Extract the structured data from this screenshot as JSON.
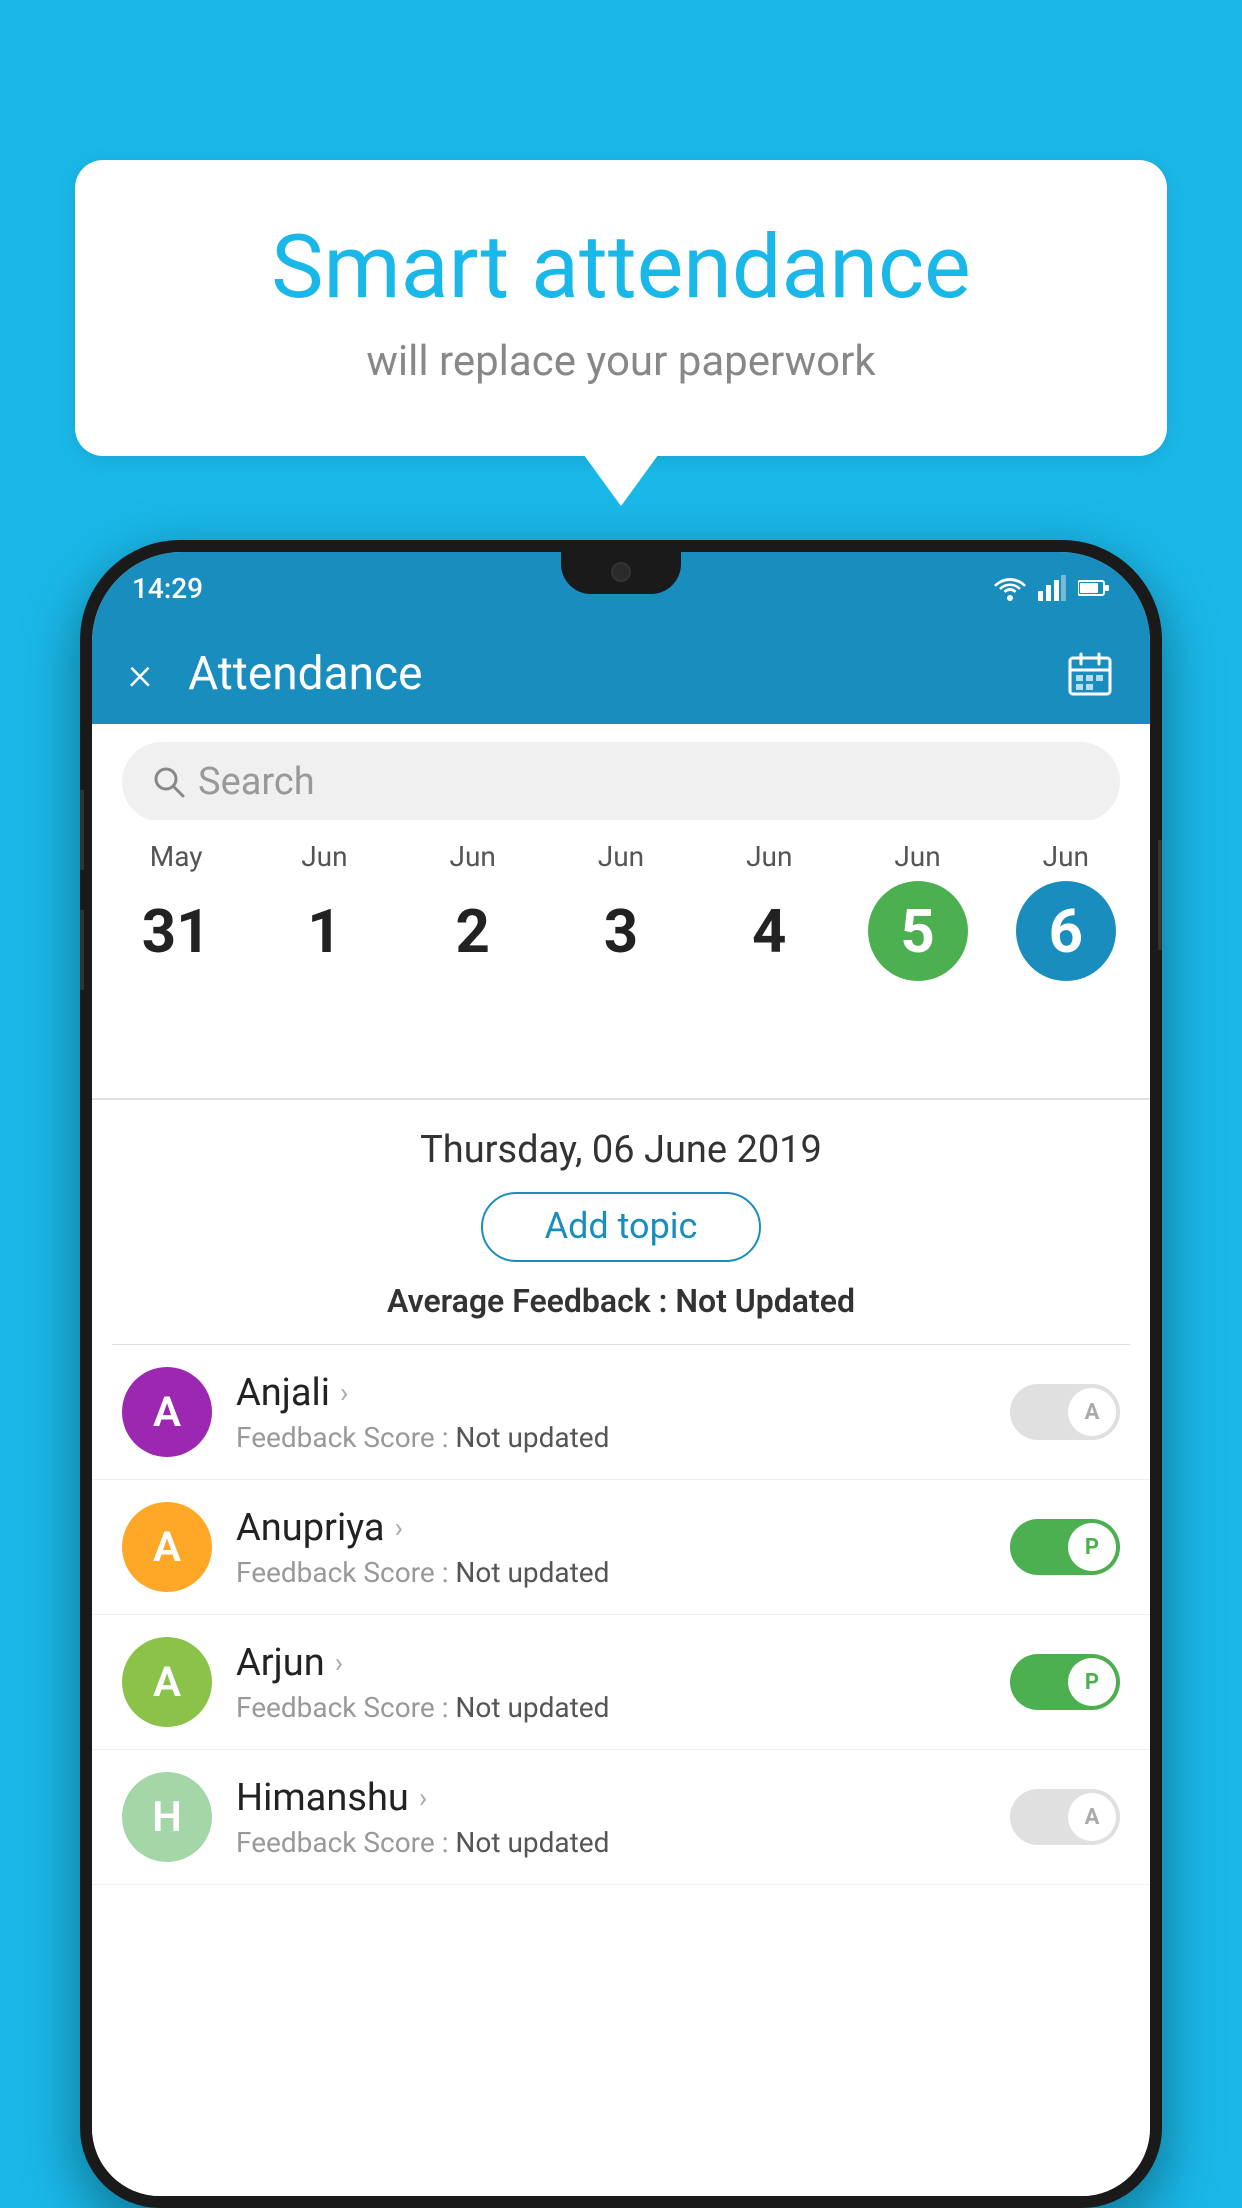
{
  "background_color": "#1ab8e8",
  "bubble": {
    "title": "Smart attendance",
    "subtitle": "will replace your paperwork"
  },
  "status_bar": {
    "time": "14:29",
    "icons": [
      "wifi",
      "signal",
      "battery"
    ]
  },
  "header": {
    "title": "Attendance",
    "close_label": "×",
    "calendar_icon": "📅"
  },
  "search": {
    "placeholder": "Search"
  },
  "dates": [
    {
      "month": "May",
      "day": "31",
      "state": "normal"
    },
    {
      "month": "Jun",
      "day": "1",
      "state": "normal"
    },
    {
      "month": "Jun",
      "day": "2",
      "state": "normal"
    },
    {
      "month": "Jun",
      "day": "3",
      "state": "normal"
    },
    {
      "month": "Jun",
      "day": "4",
      "state": "normal"
    },
    {
      "month": "Jun",
      "day": "5",
      "state": "today"
    },
    {
      "month": "Jun",
      "day": "6",
      "state": "selected"
    }
  ],
  "selected_date": "Thursday, 06 June 2019",
  "add_topic_label": "Add topic",
  "average_feedback": {
    "label": "Average Feedback : ",
    "value": "Not Updated"
  },
  "students": [
    {
      "name": "Anjali",
      "avatar_letter": "A",
      "avatar_color": "#9c27b0",
      "feedback_label": "Feedback Score : ",
      "feedback_value": "Not updated",
      "toggle_state": "off",
      "toggle_letter": "A"
    },
    {
      "name": "Anupriya",
      "avatar_letter": "A",
      "avatar_color": "#ffa726",
      "feedback_label": "Feedback Score : ",
      "feedback_value": "Not updated",
      "toggle_state": "on",
      "toggle_letter": "P"
    },
    {
      "name": "Arjun",
      "avatar_letter": "A",
      "avatar_color": "#8bc34a",
      "feedback_label": "Feedback Score : ",
      "feedback_value": "Not updated",
      "toggle_state": "on",
      "toggle_letter": "P"
    },
    {
      "name": "Himanshu",
      "avatar_letter": "H",
      "avatar_color": "#a5d6a7",
      "feedback_label": "Feedback Score : ",
      "feedback_value": "Not updated",
      "toggle_state": "off",
      "toggle_letter": "A"
    }
  ],
  "colors": {
    "primary": "#1a8dbf",
    "green": "#4caf50",
    "today_bg": "#4caf50",
    "selected_bg": "#1a8dbf"
  }
}
